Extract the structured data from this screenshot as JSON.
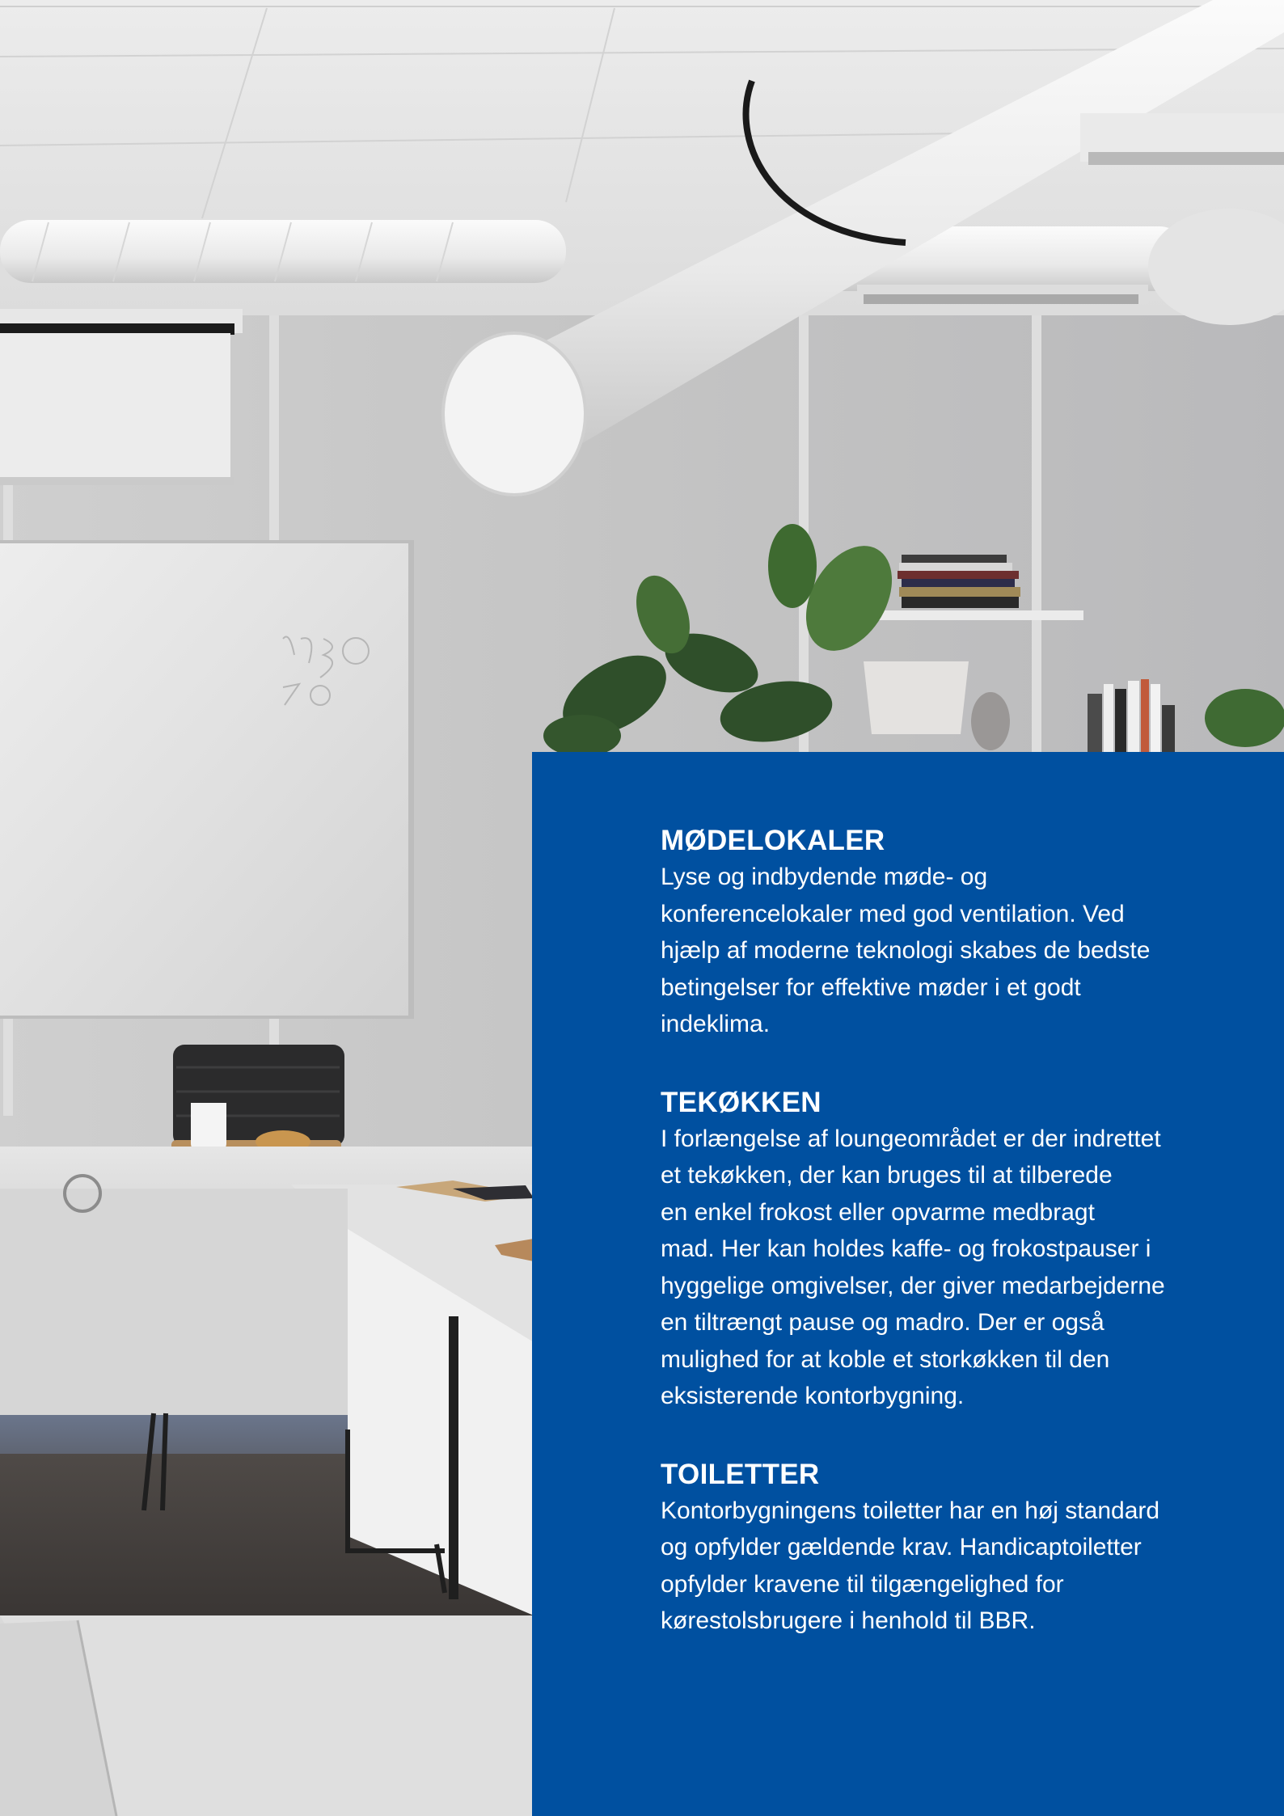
{
  "sections": [
    {
      "heading": "MØDELOKALER",
      "lines": [
        "Lyse og indbydende møde- og",
        "konferencelokaler med god ventilation. Ved",
        "hjælp af moderne teknologi skabes de bedste",
        "betingelser for effektive møder i et godt",
        "indeklima."
      ]
    },
    {
      "heading": "TEKØKKEN",
      "lines": [
        "I forlængelse af loungeområdet er der indrettet",
        "et tekøkken, der kan bruges til at tilberede",
        "en enkel frokost eller opvarme medbragt",
        "mad. Her kan holdes kaffe- og frokostpauser i",
        "hyggelige omgivelser, der giver medarbejderne",
        "en tiltrængt pause og madro. Der er også",
        "mulighed for at koble et storkøkken til den",
        "eksisterende kontorbygning."
      ]
    },
    {
      "heading": "TOILETTER",
      "lines": [
        "Kontorbygningens toiletter har en høj standard",
        "og opfylder gældende krav. Handicaptoiletter",
        "opfylder kravene til tilgængelighed for",
        "kørestolsbrugere i henhold til BBR."
      ]
    }
  ],
  "colors": {
    "panel": "#0050a0",
    "text": "#ffffff"
  }
}
